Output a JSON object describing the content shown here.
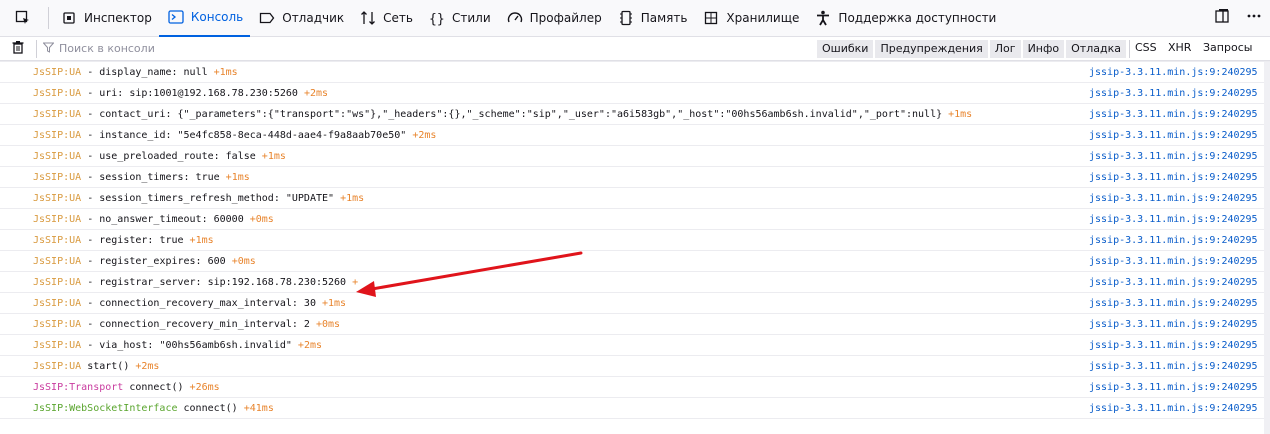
{
  "toolbar": {
    "tabs": [
      {
        "label": "Инспектор",
        "icon": "inspector-icon"
      },
      {
        "label": "Консоль",
        "icon": "console-icon",
        "active": true
      },
      {
        "label": "Отладчик",
        "icon": "debugger-icon"
      },
      {
        "label": "Сеть",
        "icon": "network-icon"
      },
      {
        "label": "Стили",
        "icon": "style-editor-icon"
      },
      {
        "label": "Профайлер",
        "icon": "profiler-icon"
      },
      {
        "label": "Память",
        "icon": "memory-icon"
      },
      {
        "label": "Хранилище",
        "icon": "storage-icon"
      },
      {
        "label": "Поддержка доступности",
        "icon": "accessibility-icon"
      }
    ]
  },
  "filterbar": {
    "search_placeholder": "Поиск в консоли",
    "levels": [
      "Ошибки",
      "Предупреждения",
      "Лог",
      "Инфо",
      "Отладка"
    ],
    "types": [
      "CSS",
      "XHR",
      "Запросы"
    ]
  },
  "colors": {
    "accent": "#0061e0",
    "namespace_ua": "#d99a3f",
    "namespace_transport": "#c93c9f",
    "namespace_ws": "#5aa52e",
    "delta": "#e8842c",
    "arrow": "#e0141b"
  },
  "source": "jssip-3.3.11.min.js:9:240295",
  "rows": [
    {
      "ns": "JsSIP:UA",
      "kind": "ua",
      "text": " - display_name: null ",
      "delta": "+1ms"
    },
    {
      "ns": "JsSIP:UA",
      "kind": "ua",
      "text": " - uri: sip:1001@192.168.78.230:5260 ",
      "delta": "+2ms"
    },
    {
      "ns": "JsSIP:UA",
      "kind": "ua",
      "text": " - contact_uri: {\"_parameters\":{\"transport\":\"ws\"},\"_headers\":{},\"_scheme\":\"sip\",\"_user\":\"a6i583gb\",\"_host\":\"00hs56amb6sh.invalid\",\"_port\":null} ",
      "delta": "+1ms"
    },
    {
      "ns": "JsSIP:UA",
      "kind": "ua",
      "text": " - instance_id: \"5e4fc858-8eca-448d-aae4-f9a8aab70e50\" ",
      "delta": "+2ms"
    },
    {
      "ns": "JsSIP:UA",
      "kind": "ua",
      "text": " - use_preloaded_route: false ",
      "delta": "+1ms"
    },
    {
      "ns": "JsSIP:UA",
      "kind": "ua",
      "text": " - session_timers: true ",
      "delta": "+1ms"
    },
    {
      "ns": "JsSIP:UA",
      "kind": "ua",
      "text": " - session_timers_refresh_method: \"UPDATE\" ",
      "delta": "+1ms"
    },
    {
      "ns": "JsSIP:UA",
      "kind": "ua",
      "text": " - no_answer_timeout: 60000 ",
      "delta": "+0ms"
    },
    {
      "ns": "JsSIP:UA",
      "kind": "ua",
      "text": " - register: true ",
      "delta": "+1ms"
    },
    {
      "ns": "JsSIP:UA",
      "kind": "ua",
      "text": " - register_expires: 600 ",
      "delta": "+0ms"
    },
    {
      "ns": "JsSIP:UA",
      "kind": "ua",
      "text": " - registrar_server: sip:192.168.78.230:5260 ",
      "delta": "+"
    },
    {
      "ns": "JsSIP:UA",
      "kind": "ua",
      "text": " - connection_recovery_max_interval: 30 ",
      "delta": "+1ms"
    },
    {
      "ns": "JsSIP:UA",
      "kind": "ua",
      "text": " - connection_recovery_min_interval: 2 ",
      "delta": "+0ms"
    },
    {
      "ns": "JsSIP:UA",
      "kind": "ua",
      "text": " - via_host: \"00hs56amb6sh.invalid\" ",
      "delta": "+2ms"
    },
    {
      "ns": "JsSIP:UA",
      "kind": "ua",
      "text": " start() ",
      "delta": "+2ms"
    },
    {
      "ns": "JsSIP:Transport",
      "kind": "tr",
      "text": " connect() ",
      "delta": "+26ms"
    },
    {
      "ns": "JsSIP:WebSocketInterface",
      "kind": "ws",
      "text": " connect() ",
      "delta": "+41ms"
    }
  ]
}
